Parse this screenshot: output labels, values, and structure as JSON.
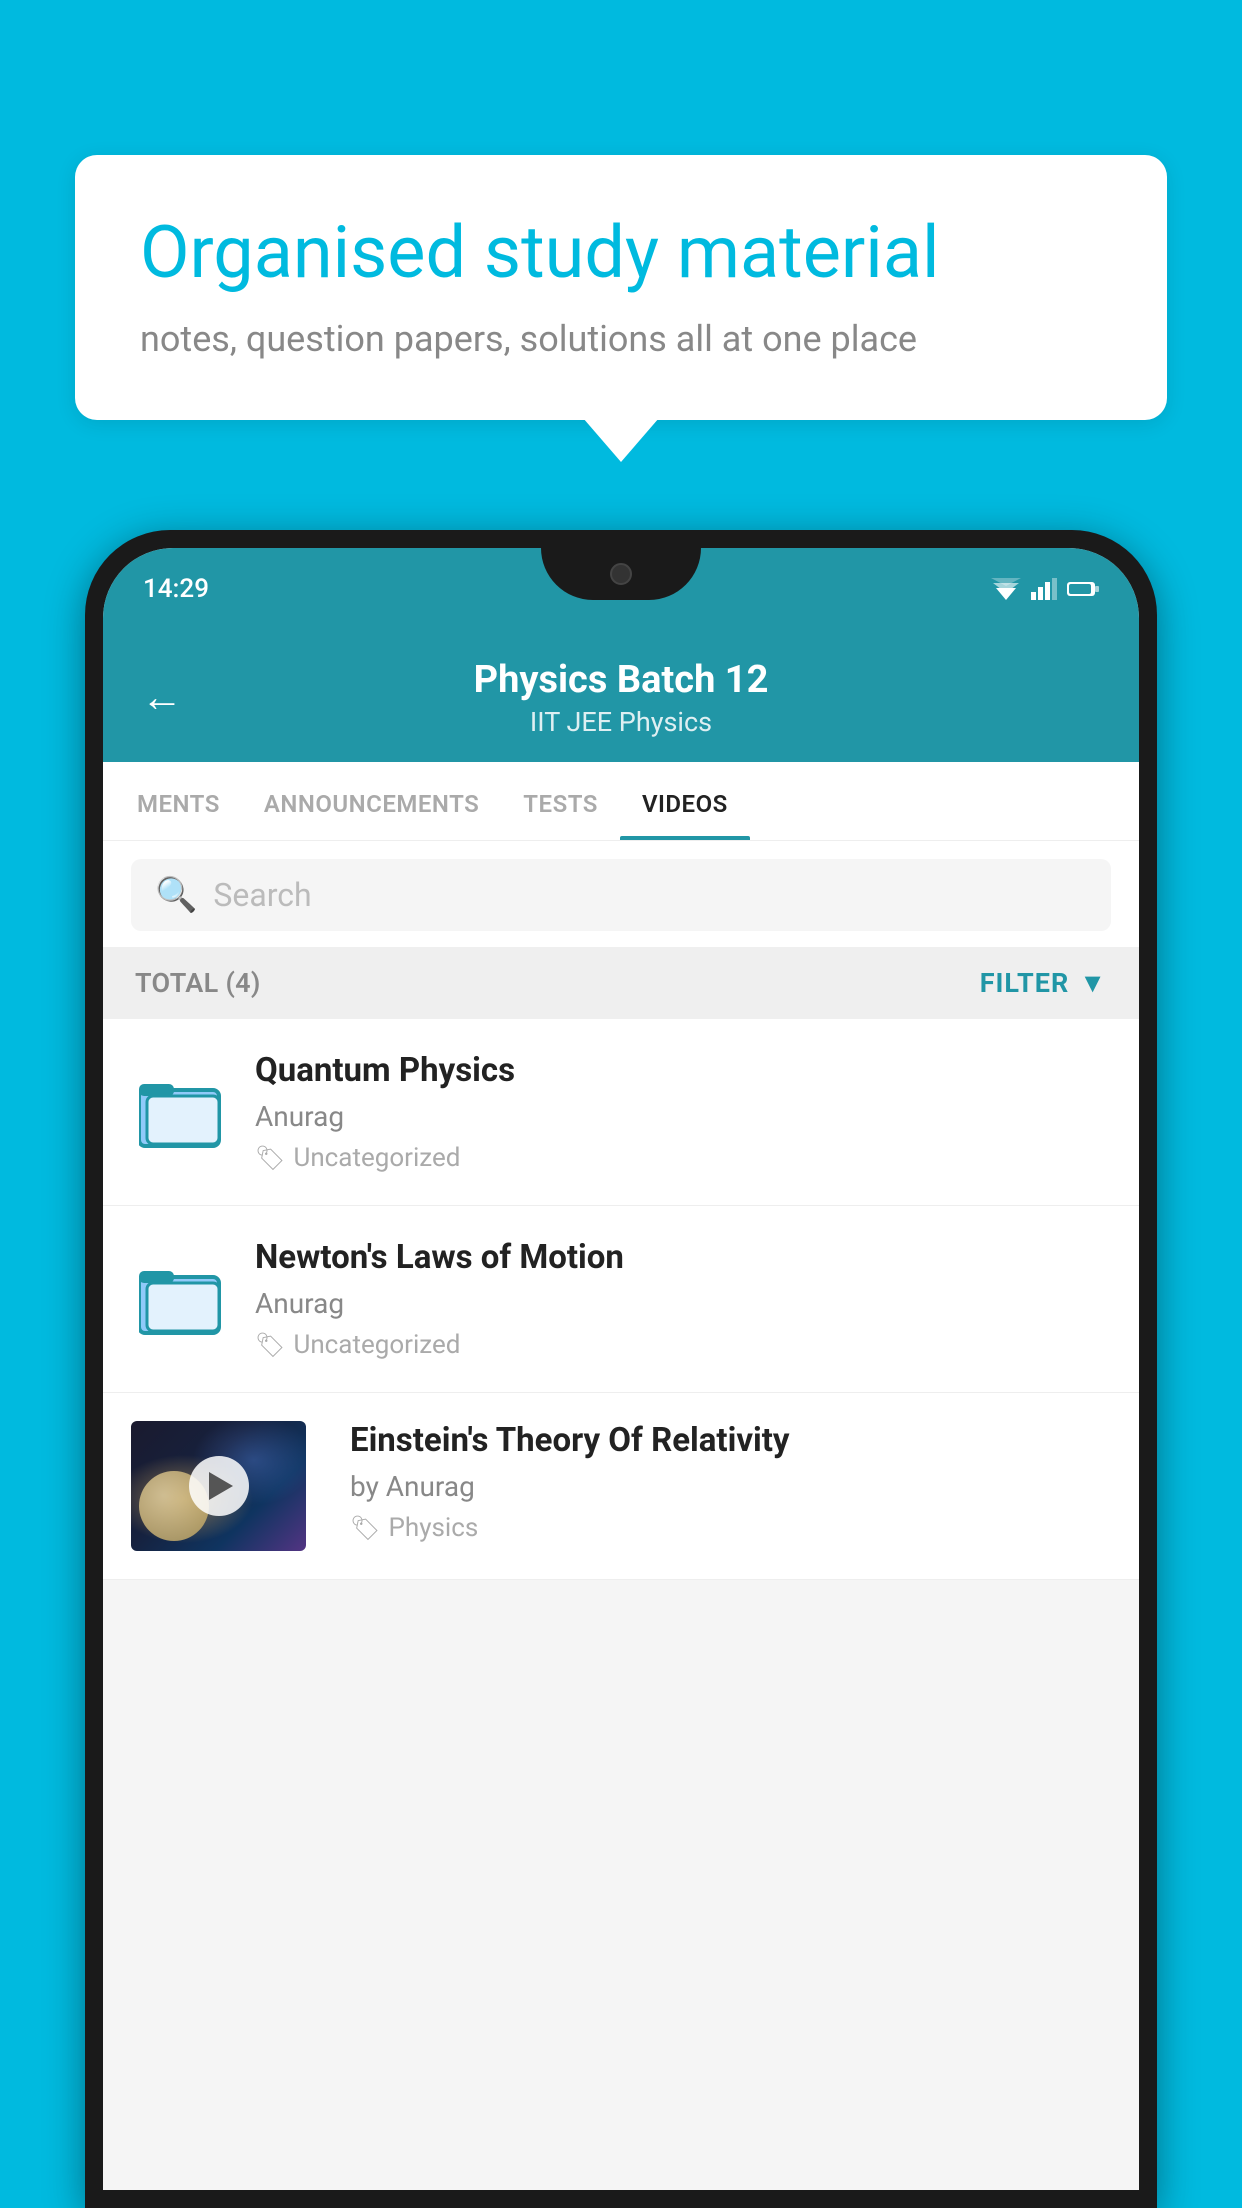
{
  "page": {
    "bg_color": "#00BADF"
  },
  "bubble": {
    "title": "Organised study material",
    "subtitle": "notes, question papers, solutions all at one place"
  },
  "status_bar": {
    "time": "14:29"
  },
  "app_header": {
    "title": "Physics Batch 12",
    "subtitle": "IIT JEE   Physics",
    "back_label": "←"
  },
  "tabs": [
    {
      "label": "MENTS",
      "active": false
    },
    {
      "label": "ANNOUNCEMENTS",
      "active": false
    },
    {
      "label": "TESTS",
      "active": false
    },
    {
      "label": "VIDEOS",
      "active": true
    }
  ],
  "search": {
    "placeholder": "Search"
  },
  "filter_bar": {
    "total_label": "TOTAL (4)",
    "filter_label": "FILTER"
  },
  "videos": [
    {
      "type": "folder",
      "title": "Quantum Physics",
      "author": "Anurag",
      "tag": "Uncategorized",
      "has_thumb": false
    },
    {
      "type": "folder",
      "title": "Newton's Laws of Motion",
      "author": "Anurag",
      "tag": "Uncategorized",
      "has_thumb": false
    },
    {
      "type": "video",
      "title": "Einstein's Theory Of Relativity",
      "author": "by Anurag",
      "tag": "Physics",
      "has_thumb": true
    }
  ]
}
